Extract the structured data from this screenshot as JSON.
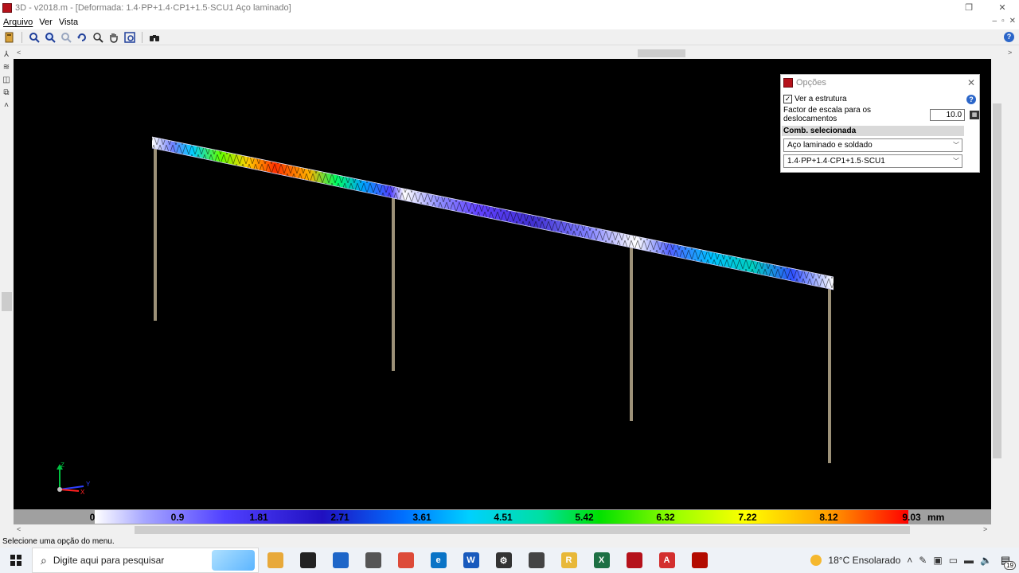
{
  "window": {
    "title": "3D - v2018.m - [Deformada: 1.4·PP+1.4·CP1+1.5·SCU1 Aço laminado]",
    "restore_glyph": "❐",
    "close_glyph": "✕"
  },
  "menu": {
    "items": [
      "Arquivo",
      "Ver",
      "Vista"
    ],
    "mdi_controls": [
      "–",
      "▫",
      "✕"
    ]
  },
  "toolbar": {
    "icons": [
      "open-icon",
      "zoom-window-icon",
      "zoom-fit-icon",
      "zoom-previous-icon",
      "rotate-icon",
      "zoom-icon",
      "pan-hand-icon",
      "zoom-extents-icon",
      "binoculars-icon"
    ]
  },
  "options_dialog": {
    "title": "Opções",
    "show_structure_label": "Ver a estrutura",
    "show_structure_checked": true,
    "scale_factor_label": "Factor de escala para os deslocamentos",
    "scale_factor_value": "10.0",
    "section_title": "Comb. selecionada",
    "material_select": "Aço laminado e soldado",
    "combination_select": "1.4·PP+1.4·CP1+1.5·SCU1"
  },
  "legend": {
    "labels": [
      "0",
      "0.9",
      "1.81",
      "2.71",
      "3.61",
      "4.51",
      "5.42",
      "6.32",
      "7.22",
      "8.12",
      "9.03"
    ],
    "unit": "mm"
  },
  "axes": {
    "z": "Z",
    "y": "Y",
    "x": "X"
  },
  "status": {
    "text": "Selecione uma opção do menu."
  },
  "taskbar": {
    "search_placeholder": "Digite aqui para pesquisar",
    "weather": "18°C  Ensolarado",
    "notification_count": "19",
    "apps": [
      {
        "name": "file-explorer",
        "letter": "",
        "color": "#e8a93a"
      },
      {
        "name": "game-app",
        "letter": "",
        "color": "#222222"
      },
      {
        "name": "store",
        "letter": "",
        "color": "#1e66c8"
      },
      {
        "name": "calculator",
        "letter": "",
        "color": "#555555"
      },
      {
        "name": "chrome",
        "letter": "",
        "color": "#dd4b39"
      },
      {
        "name": "edge",
        "letter": "e",
        "color": "#0a74c6"
      },
      {
        "name": "word",
        "letter": "W",
        "color": "#185abd"
      },
      {
        "name": "settings",
        "letter": "⚙",
        "color": "#333333"
      },
      {
        "name": "rhino",
        "letter": "",
        "color": "#444444"
      },
      {
        "name": "revit",
        "letter": "R",
        "color": "#e8b838"
      },
      {
        "name": "excel",
        "letter": "X",
        "color": "#1d7044"
      },
      {
        "name": "cypecad",
        "letter": "",
        "color": "#b5121b"
      },
      {
        "name": "autocad",
        "letter": "A",
        "color": "#d32f2f"
      },
      {
        "name": "acrobat",
        "letter": "",
        "color": "#b30b00"
      }
    ]
  }
}
